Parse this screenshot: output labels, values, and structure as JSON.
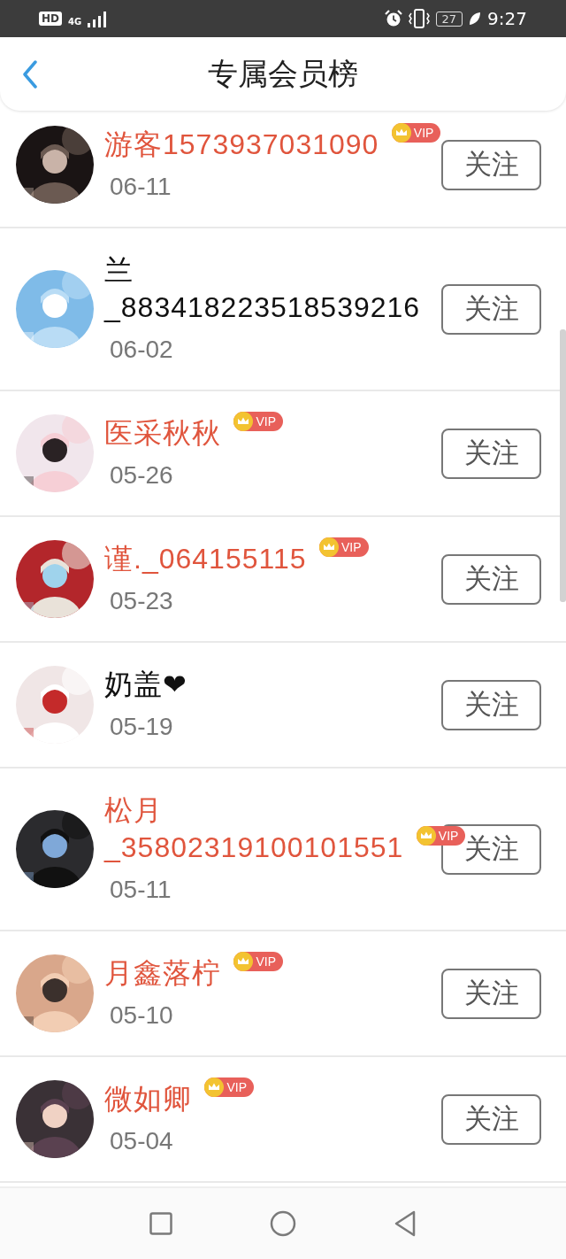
{
  "status_bar": {
    "hd": "HD",
    "network": "4G",
    "battery": "27",
    "time": "9:27"
  },
  "header": {
    "title": "专属会员榜"
  },
  "members": [
    {
      "name": "游客1573937031090",
      "date": "06-11",
      "vip": true,
      "badge": "VIP",
      "button": "关注"
    },
    {
      "name": "兰_883418223518539216",
      "date": "06-02",
      "vip": false,
      "button": "关注"
    },
    {
      "name": "医采秋秋",
      "date": "05-26",
      "vip": true,
      "badge": "VIP",
      "button": "关注"
    },
    {
      "name": "谨._064155115",
      "date": "05-23",
      "vip": true,
      "badge": "VIP",
      "button": "关注"
    },
    {
      "name": "奶盖❤",
      "date": "05-19",
      "vip": false,
      "button": "关注"
    },
    {
      "name": "松月_35802319100101551",
      "date": "05-11",
      "vip": true,
      "badge": "VIP",
      "button": "关注"
    },
    {
      "name": "月鑫落柠",
      "date": "05-10",
      "vip": true,
      "badge": "VIP",
      "button": "关注"
    },
    {
      "name": "微如卿",
      "date": "05-04",
      "vip": true,
      "badge": "VIP",
      "button": "关注"
    }
  ]
}
